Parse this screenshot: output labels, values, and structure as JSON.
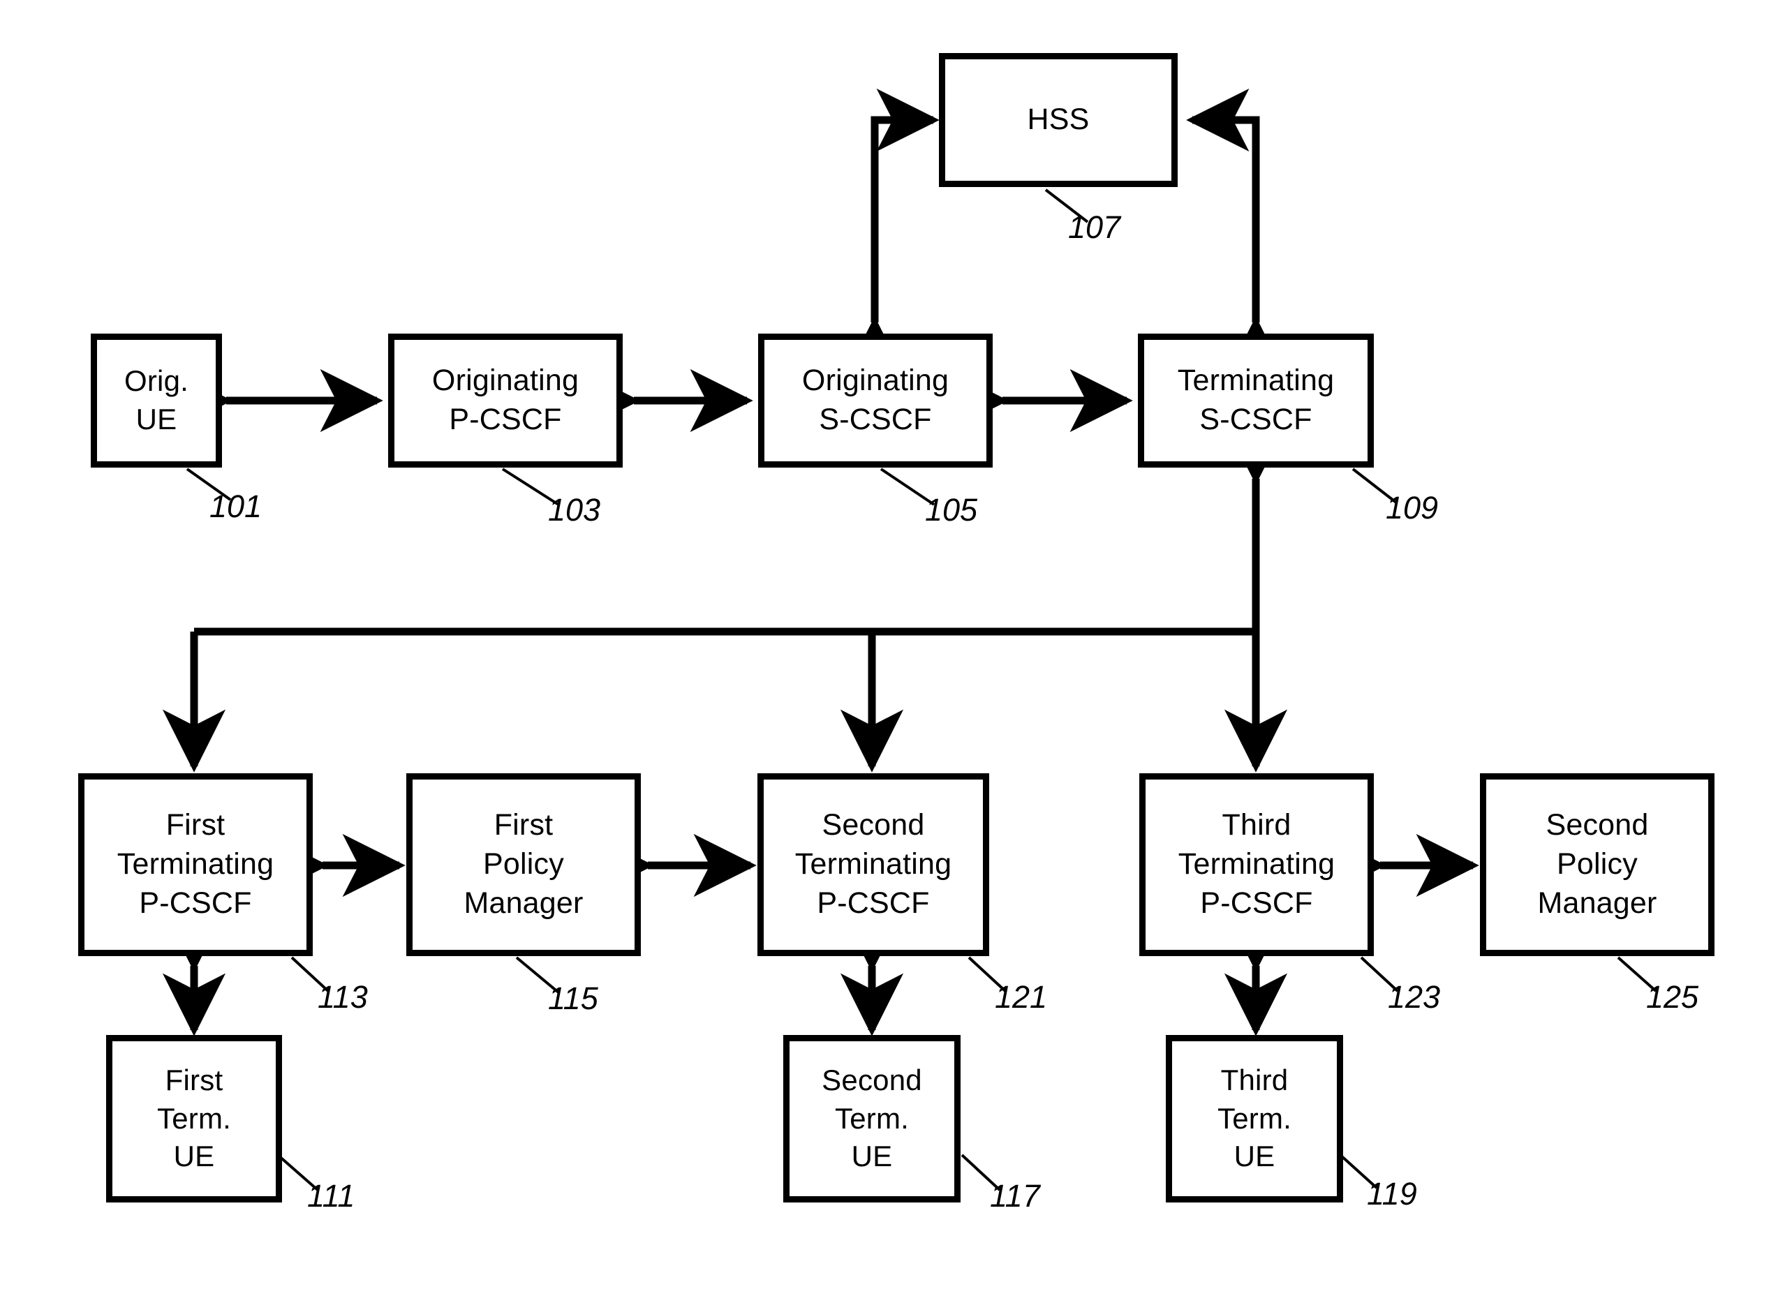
{
  "figure": {
    "type": "patent-block-diagram",
    "background": "#ffffff",
    "line_color": "#000000"
  },
  "nodes": [
    {
      "id": "hss",
      "label": "HSS",
      "ref": "107"
    },
    {
      "id": "orig_ue",
      "label": "Orig.\nUE",
      "ref": "101"
    },
    {
      "id": "orig_pcscf",
      "label": "Originating\nP-CSCF",
      "ref": "103"
    },
    {
      "id": "orig_scscf",
      "label": "Originating\nS-CSCF",
      "ref": "105"
    },
    {
      "id": "term_scscf",
      "label": "Terminating\nS-CSCF",
      "ref": "109"
    },
    {
      "id": "t1_pcscf",
      "label": "First\nTerminating\nP-CSCF",
      "ref": "113"
    },
    {
      "id": "pm1",
      "label": "First\nPolicy\nManager",
      "ref": "115"
    },
    {
      "id": "t2_pcscf",
      "label": "Second\nTerminating\nP-CSCF",
      "ref": "121"
    },
    {
      "id": "t3_pcscf",
      "label": "Third\nTerminating\nP-CSCF",
      "ref": "123"
    },
    {
      "id": "pm2",
      "label": "Second\nPolicy\nManager",
      "ref": "125"
    },
    {
      "id": "t1_ue",
      "label": "First\nTerm.\nUE",
      "ref": "111"
    },
    {
      "id": "t2_ue",
      "label": "Second\nTerm.\nUE",
      "ref": "117"
    },
    {
      "id": "t3_ue",
      "label": "Third\nTerm.\nUE",
      "ref": "119"
    }
  ],
  "connections": [
    {
      "from": "orig_ue",
      "to": "orig_pcscf",
      "arrows": "both"
    },
    {
      "from": "orig_pcscf",
      "to": "orig_scscf",
      "arrows": "both"
    },
    {
      "from": "orig_scscf",
      "to": "term_scscf",
      "arrows": "both"
    },
    {
      "from": "orig_scscf",
      "to": "hss",
      "arrows": "both"
    },
    {
      "from": "term_scscf",
      "to": "hss",
      "arrows": "both"
    },
    {
      "from": "term_scscf",
      "to": "t1_pcscf",
      "arrows": "to"
    },
    {
      "from": "term_scscf",
      "to": "t2_pcscf",
      "arrows": "to"
    },
    {
      "from": "term_scscf",
      "to": "t3_pcscf",
      "arrows": "both"
    },
    {
      "from": "t1_pcscf",
      "to": "pm1",
      "arrows": "both"
    },
    {
      "from": "pm1",
      "to": "t2_pcscf",
      "arrows": "both"
    },
    {
      "from": "t3_pcscf",
      "to": "pm2",
      "arrows": "both"
    },
    {
      "from": "t1_pcscf",
      "to": "t1_ue",
      "arrows": "both"
    },
    {
      "from": "t2_pcscf",
      "to": "t2_ue",
      "arrows": "both"
    },
    {
      "from": "t3_pcscf",
      "to": "t3_ue",
      "arrows": "both"
    }
  ],
  "refs": {
    "n101": "101",
    "n103": "103",
    "n105": "105",
    "n107": "107",
    "n109": "109",
    "n111": "111",
    "n113": "113",
    "n115": "115",
    "n117": "117",
    "n119": "119",
    "n121": "121",
    "n123": "123",
    "n125": "125"
  },
  "labels": {
    "hss": "HSS",
    "orig_ue": "Orig.\nUE",
    "orig_pcscf": "Originating\nP-CSCF",
    "orig_scscf": "Originating\nS-CSCF",
    "term_scscf": "Terminating\nS-CSCF",
    "t1_pcscf": "First\nTerminating\nP-CSCF",
    "pm1": "First\nPolicy\nManager",
    "t2_pcscf": "Second\nTerminating\nP-CSCF",
    "t3_pcscf": "Third\nTerminating\nP-CSCF",
    "pm2": "Second\nPolicy\nManager",
    "t1_ue": "First\nTerm.\nUE",
    "t2_ue": "Second\nTerm.\nUE",
    "t3_ue": "Third\nTerm.\nUE"
  }
}
